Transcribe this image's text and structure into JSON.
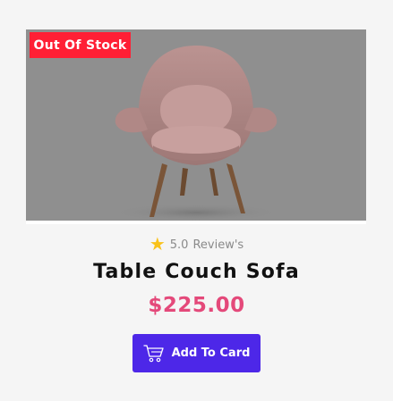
{
  "product": {
    "badge": "Out Of Stock",
    "rating_value": "5.0",
    "rating_label": "Review's",
    "title": "Table Couch Sofa",
    "price": "$225.00",
    "add_button_label": "Add To Card",
    "icons": {
      "rating": "star-icon",
      "button": "cart-icon"
    }
  },
  "colors": {
    "badge_bg": "#ff1f35",
    "price": "#e4497a",
    "button_bg": "#4d27e8",
    "star": "#f9c21a"
  }
}
